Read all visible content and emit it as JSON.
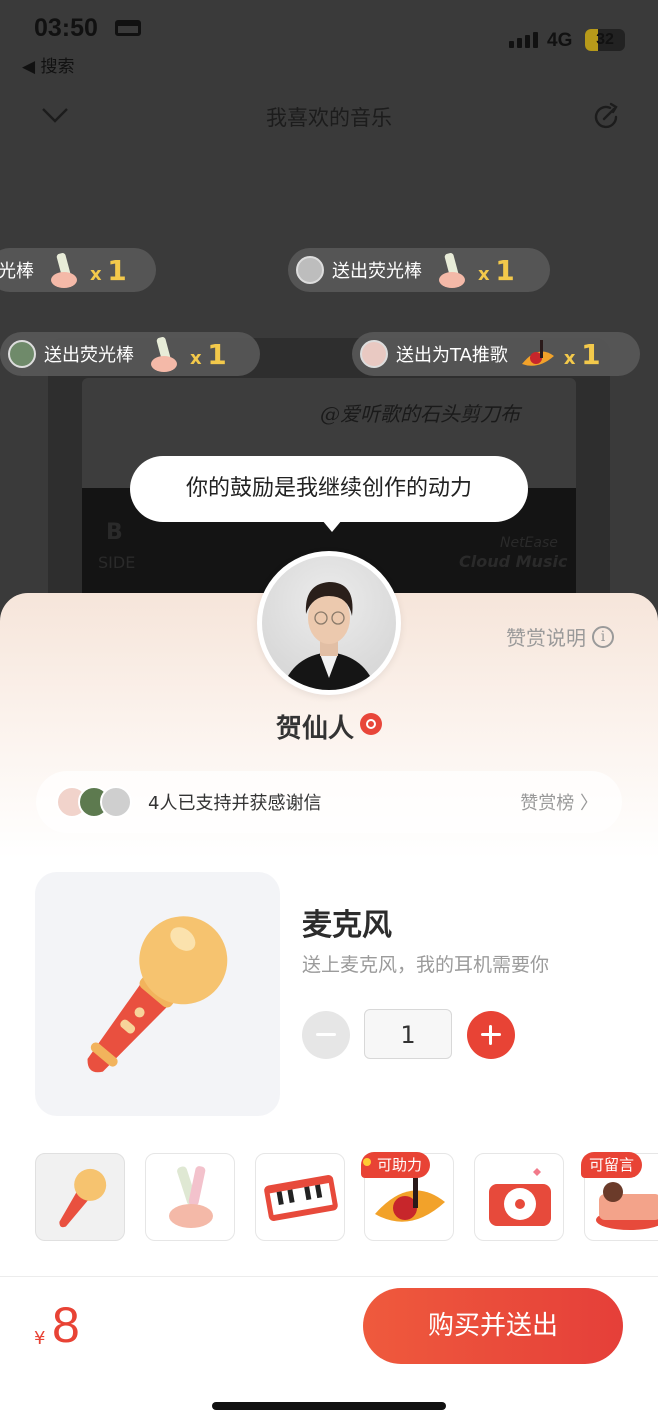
{
  "status": {
    "time": "03:50",
    "back_label": "◀ 搜索",
    "network": "4G",
    "battery": "32",
    "battery_level": 0.32
  },
  "header": {
    "title": "我喜欢的音乐"
  },
  "cassette": {
    "signature": "@爱听歌的石头剪刀布",
    "side_letter": "B",
    "side_text": "SIDE",
    "brand_line1": "NetEase",
    "brand_line2": "Cloud Music"
  },
  "gift_feed": [
    {
      "text": "光棒",
      "x_label": "x",
      "count": "1"
    },
    {
      "text": "送出荧光棒",
      "x_label": "x",
      "count": "1"
    },
    {
      "text": "送出荧光棒",
      "x_label": "x",
      "count": "1"
    },
    {
      "text": "送出为TA推歌",
      "x_label": "x",
      "count": "1"
    }
  ],
  "bubble": {
    "text": "你的鼓励是我继续创作的动力"
  },
  "sheet": {
    "explain_label": "赞赏说明",
    "info_icon": "i",
    "artist_name": "贺仙人",
    "supporters_text": "4人已支持并获感谢信",
    "rank_label": "赞赏榜 〉",
    "gift": {
      "name": "麦克风",
      "description": "送上麦克风，我的耳机需要你",
      "quantity": "1"
    },
    "gift_tags": [
      "可助力",
      "可留言"
    ],
    "price_symbol": "¥",
    "price": "8",
    "buy_label": "购买并送出"
  },
  "colors": {
    "accent": "#e84335",
    "gold": "#f3c94b",
    "sheet_top": "#f6e5da"
  }
}
